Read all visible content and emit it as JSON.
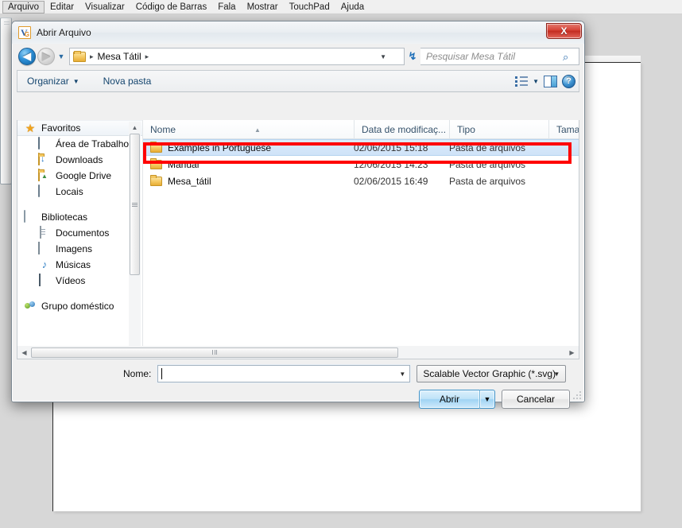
{
  "app": {
    "menubar": [
      {
        "label": "Arquivo",
        "active": true
      },
      {
        "label": "Editar",
        "active": false
      },
      {
        "label": "Visualizar",
        "active": false
      },
      {
        "label": "Código de Barras",
        "active": false
      },
      {
        "label": "Fala",
        "active": false
      },
      {
        "label": "Mostrar",
        "active": false
      },
      {
        "label": "TouchPad",
        "active": false
      },
      {
        "label": "Ajuda",
        "active": false
      }
    ]
  },
  "dialog": {
    "title": "Abrir Arquivo",
    "close_label": "X",
    "nav": {
      "back_glyph": "◀",
      "forward_glyph": "▶",
      "history_glyph": "▼",
      "breadcrumb_root_sep": "▸",
      "breadcrumb_label": "Mesa Tátil",
      "breadcrumb_trailing_sep": "▸",
      "breadcrumb_dropdown_glyph": "▼",
      "refresh_glyph": "↯"
    },
    "search": {
      "placeholder": "Pesquisar Mesa Tátil",
      "icon_glyph": "⌕"
    },
    "toolbar": {
      "organize_label": "Organizar",
      "organize_caret": "▼",
      "new_folder_label": "Nova pasta",
      "view_caret": "▼",
      "help_glyph": "?"
    },
    "sidebar": {
      "groups": [
        {
          "name": "Favoritos",
          "icon": "star-icon",
          "highlighted": true,
          "items": [
            {
              "label": "Área de Trabalho",
              "icon": "desktop-icon"
            },
            {
              "label": "Downloads",
              "icon": "downloads-folder-icon"
            },
            {
              "label": "Google Drive",
              "icon": "google-drive-folder-icon"
            },
            {
              "label": "Locais",
              "icon": "network-places-icon"
            }
          ]
        },
        {
          "name": "Bibliotecas",
          "icon": "libraries-icon",
          "highlighted": false,
          "items": [
            {
              "label": "Documentos",
              "icon": "documents-icon"
            },
            {
              "label": "Imagens",
              "icon": "pictures-icon"
            },
            {
              "label": "Músicas",
              "icon": "music-icon"
            },
            {
              "label": "Vídeos",
              "icon": "videos-icon"
            }
          ]
        },
        {
          "name": "Grupo doméstico",
          "icon": "homegroup-icon",
          "highlighted": false,
          "items": []
        }
      ],
      "scroll_up_glyph": "▲"
    },
    "filelist": {
      "columns": [
        {
          "key": "name",
          "label": "Nome",
          "sorted": true,
          "sort_glyph": "▲"
        },
        {
          "key": "date",
          "label": "Data de modificaç...",
          "sorted": false
        },
        {
          "key": "type",
          "label": "Tipo",
          "sorted": false
        },
        {
          "key": "size",
          "label": "Tama",
          "sorted": false
        }
      ],
      "rows": [
        {
          "name": "Examples in Portuguese",
          "date": "02/06/2015 15:18",
          "type": "Pasta de arquivos",
          "size": "",
          "selected": true,
          "highlighted": true
        },
        {
          "name": "Manual",
          "date": "12/06/2015 14:23",
          "type": "Pasta de arquivos",
          "size": "",
          "selected": false,
          "highlighted": false
        },
        {
          "name": "Mesa_tátil",
          "date": "02/06/2015 16:49",
          "type": "Pasta de arquivos",
          "size": "",
          "selected": false,
          "highlighted": false
        }
      ],
      "hscroll_left_glyph": "◀",
      "hscroll_right_glyph": "▶"
    },
    "form": {
      "filename_label": "Nome:",
      "filename_value": "",
      "filename_arrow": "▼",
      "filter_value": "Scalable Vector Graphic (*.svg)",
      "filter_arrow": "▼",
      "open_label": "Abrir",
      "open_caret": "▼",
      "cancel_label": "Cancelar"
    }
  },
  "colors": {
    "annotation": "#ff0000",
    "selection": "#cfe3f8",
    "accent": "#3f93c9"
  }
}
